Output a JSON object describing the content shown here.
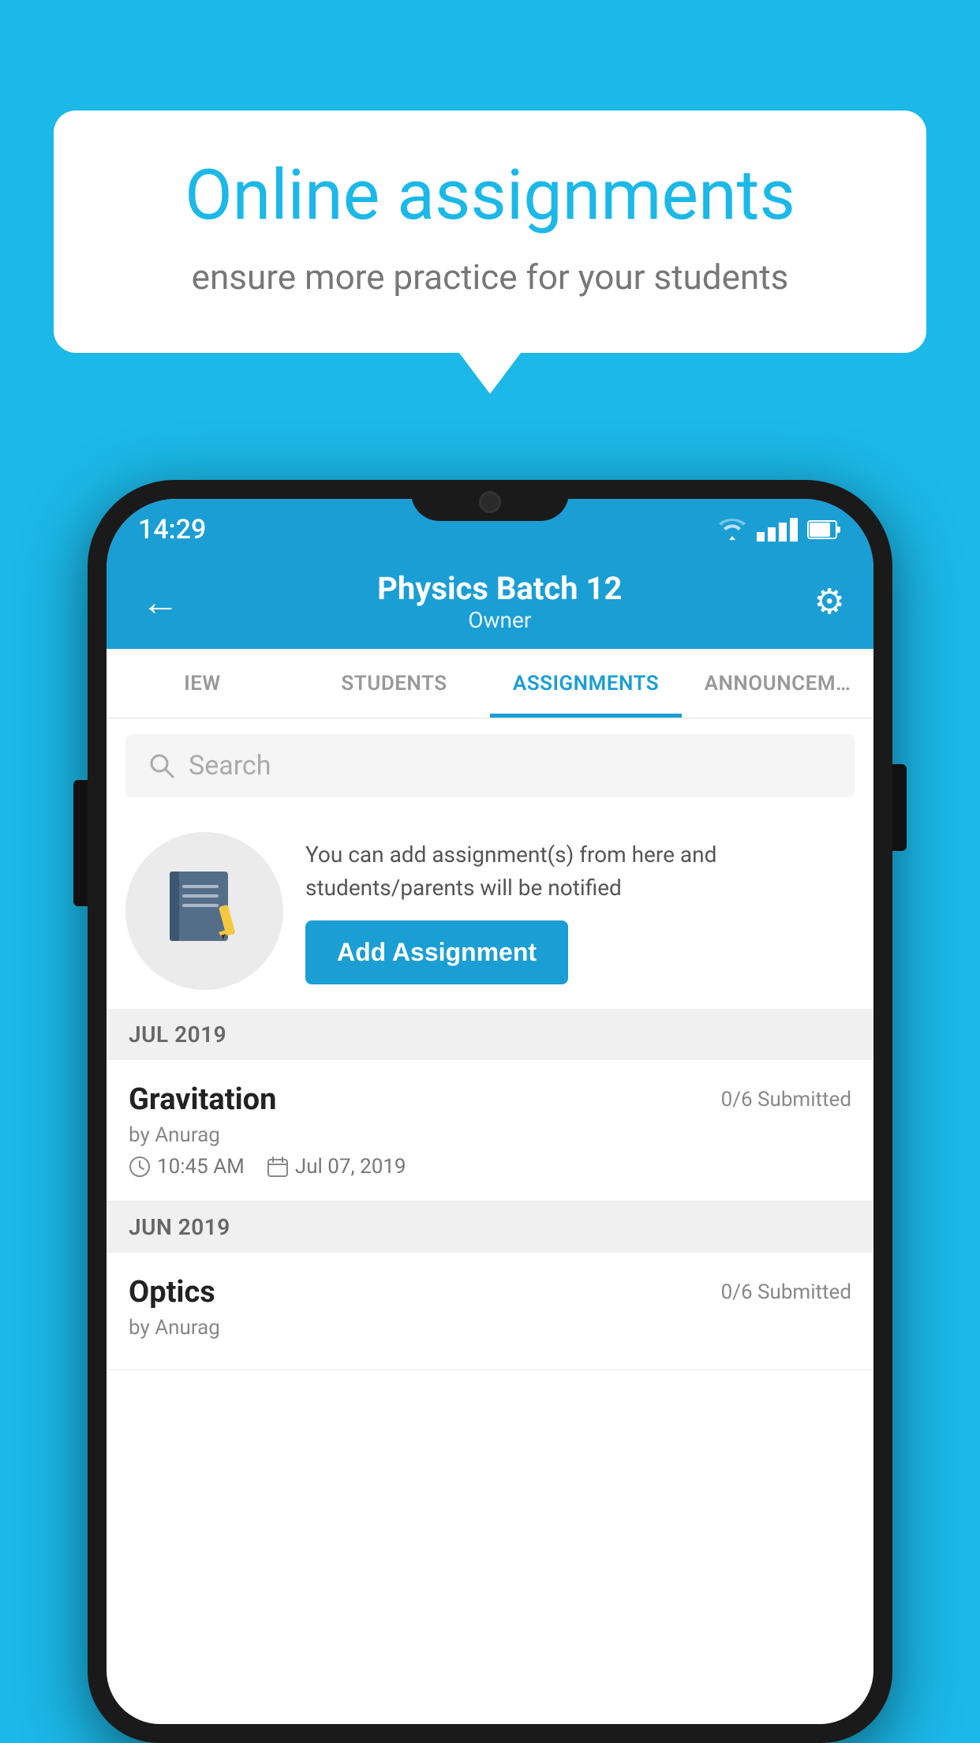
{
  "background": {
    "color": "#1bb8e8"
  },
  "speech_bubble": {
    "title": "Online assignments",
    "subtitle": "ensure more practice for your students"
  },
  "phone": {
    "status_bar": {
      "time": "14:29"
    },
    "header": {
      "back_label": "←",
      "batch_name": "Physics Batch 12",
      "role": "Owner",
      "gear_label": "⚙"
    },
    "tabs": [
      {
        "label": "IEW",
        "active": false
      },
      {
        "label": "STUDENTS",
        "active": false
      },
      {
        "label": "ASSIGNMENTS",
        "active": true
      },
      {
        "label": "ANNOUNCEM…",
        "active": false
      }
    ],
    "search": {
      "placeholder": "Search"
    },
    "promo": {
      "description": "You can add assignment(s) from here and students/parents will be notified",
      "button_label": "Add Assignment"
    },
    "assignments": [
      {
        "month_label": "JUL 2019",
        "items": [
          {
            "name": "Gravitation",
            "status": "0/6 Submitted",
            "by": "by Anurag",
            "time": "10:45 AM",
            "date": "Jul 07, 2019"
          }
        ]
      },
      {
        "month_label": "JUN 2019",
        "items": [
          {
            "name": "Optics",
            "status": "0/6 Submitted",
            "by": "by Anurag",
            "time": "",
            "date": ""
          }
        ]
      }
    ]
  }
}
